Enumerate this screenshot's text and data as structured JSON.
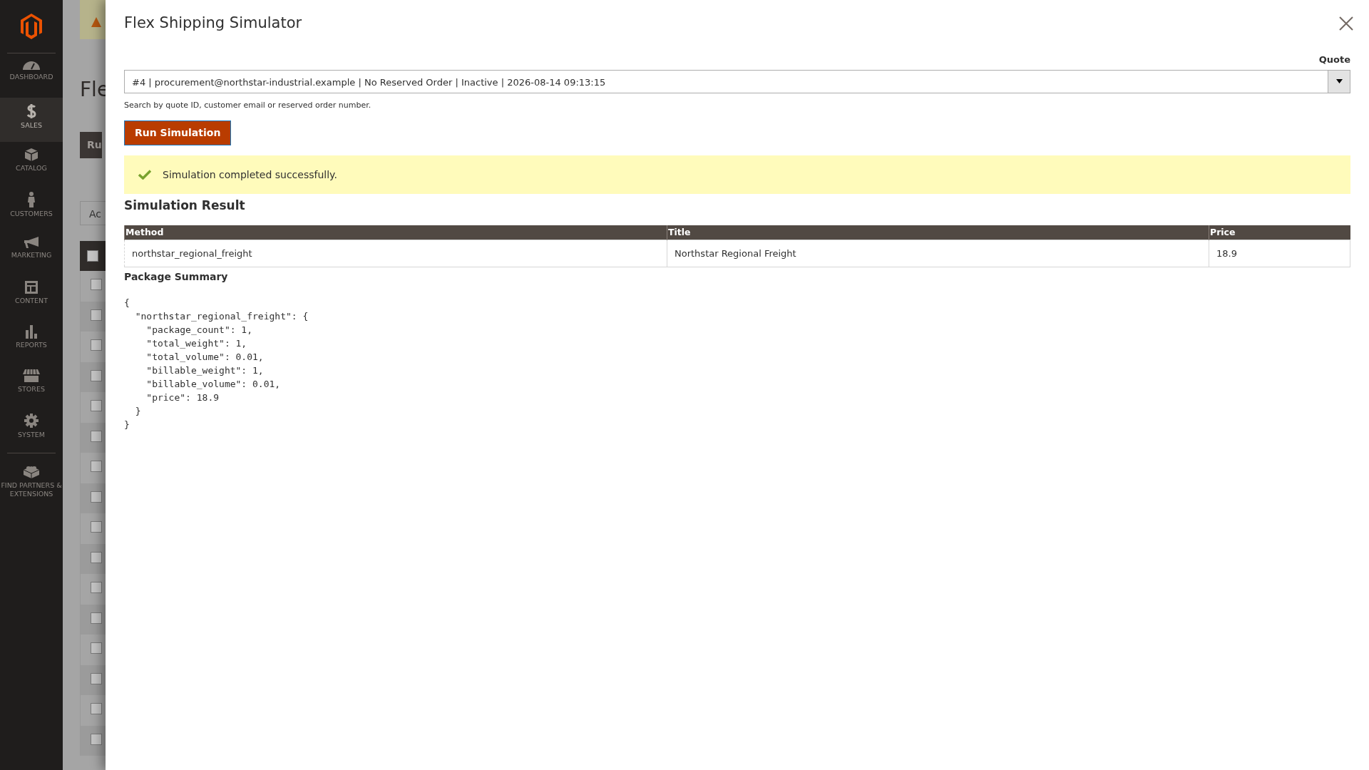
{
  "sidebar": {
    "items": [
      {
        "label": "DASHBOARD",
        "selected": false
      },
      {
        "label": "SALES",
        "selected": true
      },
      {
        "label": "CATALOG",
        "selected": false
      },
      {
        "label": "CUSTOMERS",
        "selected": false
      },
      {
        "label": "MARKETING",
        "selected": false
      },
      {
        "label": "CONTENT",
        "selected": false
      },
      {
        "label": "REPORTS",
        "selected": false
      },
      {
        "label": "STORES",
        "selected": false
      },
      {
        "label": "SYSTEM",
        "selected": false
      },
      {
        "label": "FIND PARTNERS & EXTENSIONS",
        "selected": false
      }
    ]
  },
  "background_page": {
    "title": "Fle",
    "button": "Ru",
    "field": "Ac",
    "header_checked": false,
    "rows": [
      {
        "checked": false
      },
      {
        "checked": false
      },
      {
        "checked": false
      },
      {
        "checked": false
      },
      {
        "checked": false
      },
      {
        "checked": false
      },
      {
        "checked": false
      },
      {
        "checked": false
      },
      {
        "checked": false
      },
      {
        "checked": false
      },
      {
        "checked": false
      },
      {
        "checked": false
      },
      {
        "checked": false
      },
      {
        "checked": false
      },
      {
        "checked": false
      },
      {
        "checked": false
      }
    ]
  },
  "modal": {
    "title": "Flex Shipping Simulator",
    "quote": {
      "label": "Quote",
      "value": "#4 | procurement@northstar-industrial.example | No Reserved Order | Inactive | 2026-08-14 09:13:15",
      "hint": "Search by quote ID, customer email or reserved order number."
    },
    "run_button": "Run Simulation",
    "message": {
      "kind": "success",
      "text": "Simulation completed successfully."
    },
    "result_heading": "Simulation Result",
    "table": {
      "columns": [
        "Method",
        "Title",
        "Price"
      ],
      "rows": [
        [
          "northstar_regional_freight",
          "Northstar Regional Freight",
          "18.9"
        ]
      ]
    },
    "summary_heading": "Package Summary",
    "summary_lines": [
      "{",
      "  \"northstar_regional_freight\": {",
      "    \"package_count\": 1,",
      "    \"total_weight\": 1,",
      "    \"total_volume\": 0.01,",
      "    \"billable_weight\": 1,",
      "    \"billable_volume\": 0.01,",
      "    \"price\": 18.9",
      "  }",
      "}"
    ]
  }
}
